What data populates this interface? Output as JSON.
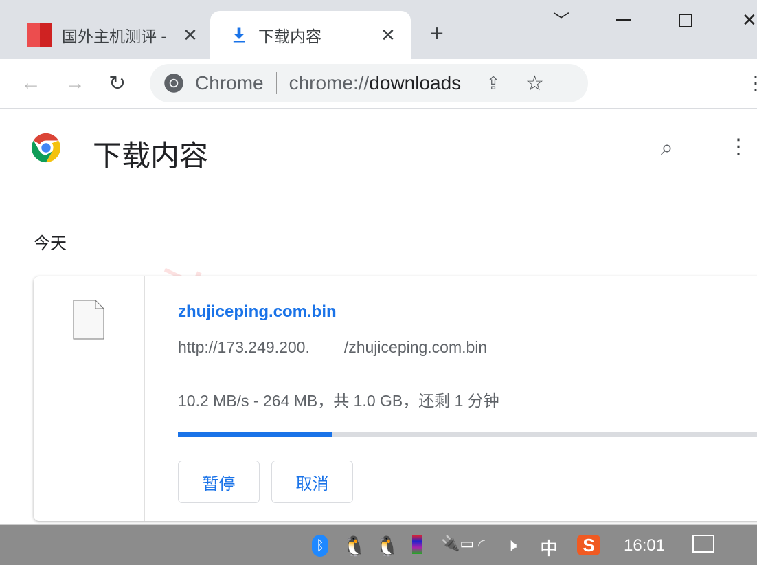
{
  "tabs": [
    {
      "title": "国外主机测评 -",
      "active": false
    },
    {
      "title": "下载内容",
      "active": true
    }
  ],
  "omnibox": {
    "site_label": "Chrome",
    "url_scheme": "chrome://",
    "url_path": "downloads"
  },
  "page": {
    "title": "下载内容",
    "section": "今天"
  },
  "watermark": "zhujiceping.com",
  "download": {
    "filename": "zhujiceping.com.bin",
    "url_prefix": "http://173.249.200.",
    "url_suffix": "/zhujiceping.com.bin",
    "status": "10.2 MB/s - 264 MB，共 1.0 GB，还剩 1 分钟",
    "progress_percent": 26,
    "pause_label": "暂停",
    "cancel_label": "取消"
  },
  "taskbar": {
    "time": "16:01",
    "ime": "中"
  },
  "colors": {
    "accent": "#1a73e8",
    "progress_track": "#dadce0",
    "tabbar": "#dee1e6",
    "taskbar": "#8c8c8c"
  }
}
